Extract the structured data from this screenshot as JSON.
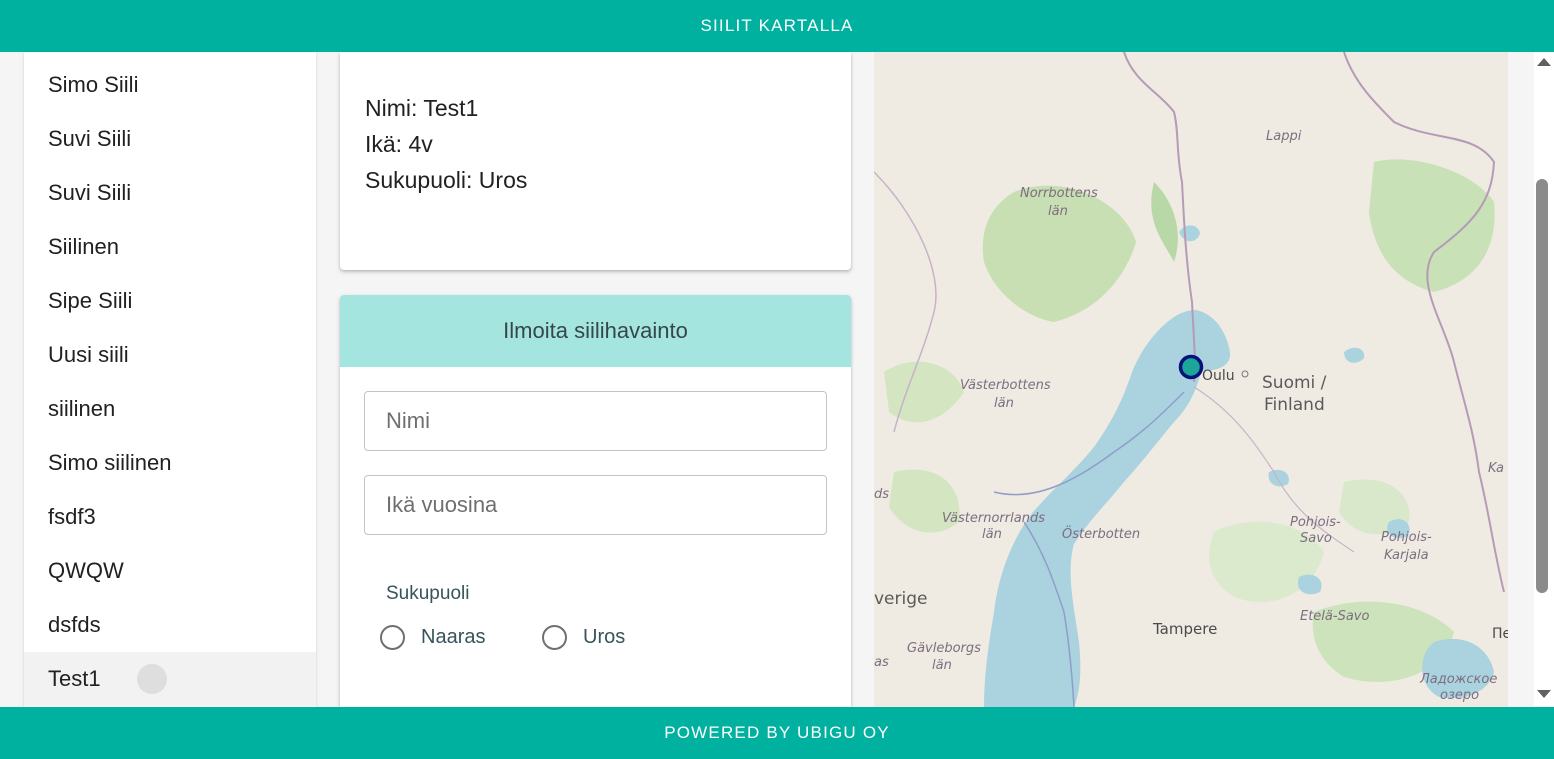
{
  "header": {
    "title": "SIILIT KARTALLA"
  },
  "footer": {
    "text": "POWERED BY UBIGU OY"
  },
  "sidebar": {
    "items": [
      "Simo Siili",
      "Suvi Siili",
      "Suvi Siili",
      "Siilinen",
      "Sipe Siili",
      "Uusi siili",
      "siilinen",
      "Simo siilinen",
      "fsdf3",
      "QWQW",
      "dsfds",
      "Test1"
    ],
    "selected_index": 11
  },
  "details": {
    "name": "Nimi: Test1",
    "age": "Ikä: 4v",
    "gender": "Sukupuoli: Uros"
  },
  "form": {
    "title": "Ilmoita siilihavainto",
    "name_placeholder": "Nimi",
    "age_placeholder": "Ikä vuosina",
    "gender_label": "Sukupuoli",
    "gender_options": [
      "Naaras",
      "Uros"
    ]
  },
  "map": {
    "labels": {
      "lappi": "Lappi",
      "norrbottens_1": "Norrbottens",
      "norrbottens_2": "län",
      "vasterbottens_1": "Västerbottens",
      "vasterbottens_2": "län",
      "oulu": "Oulu",
      "suomi_1": "Suomi /",
      "suomi_2": "Finland",
      "vasternorrlands_1": "Västernorrlands",
      "vasternorrlands_2": "län",
      "osterbotten": "Österbotten",
      "pohjois_savo_1": "Pohjois-",
      "pohjois_savo_2": "Savo",
      "pohjois_karjala_1": "Pohjois-",
      "pohjois_karjala_2": "Karjala",
      "sverige": "verige",
      "tampere": "Tampere",
      "etela_savo": "Etelä-Savo",
      "gavleborgs_1": "Gävleborgs",
      "gavleborgs_2": "län",
      "ladoga_1": "Ладожское",
      "ladoga_2": "озеро",
      "edge_ds": "ds",
      "edge_as": "as",
      "edge_ka": "Ka",
      "edge_pe": "Пе"
    },
    "marker": {
      "location": "Oulu",
      "fill": "#1ea59a",
      "stroke": "#06117a"
    },
    "colors": {
      "water": "#aad3df",
      "land": "#efebe3",
      "forest": "#add19e"
    }
  }
}
